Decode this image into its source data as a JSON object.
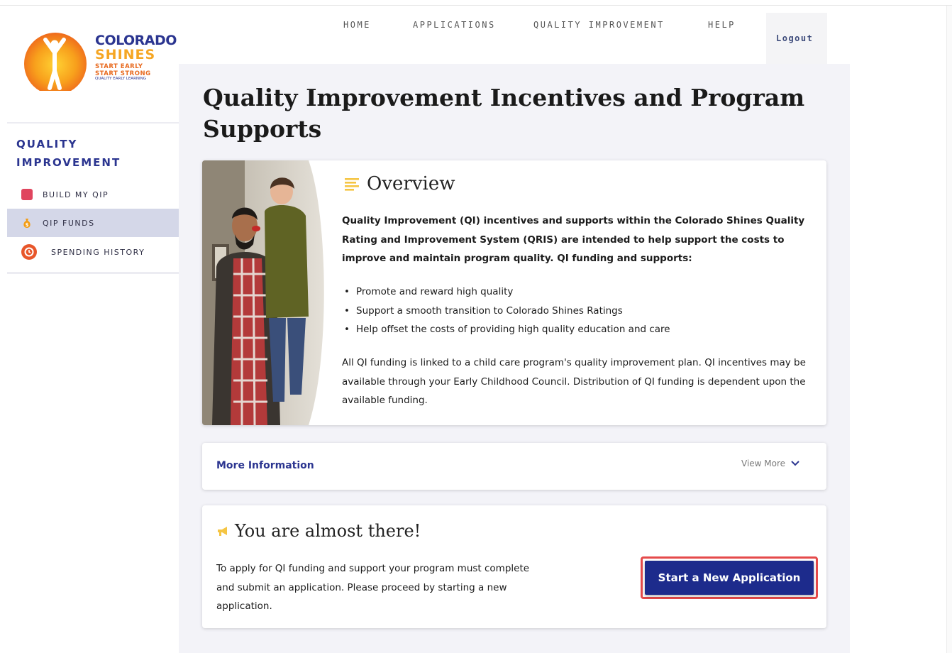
{
  "logo": {
    "line1": "COLORADO",
    "line2": "SHINES",
    "line3": "START EARLY",
    "line4": "START STRONG",
    "line5": "QUALITY EARLY LEARNING"
  },
  "nav": {
    "items": [
      "HOME",
      "APPLICATIONS",
      "QUALITY IMPROVEMENT",
      "HELP"
    ],
    "logout": "Logout"
  },
  "sidebar": {
    "title_line1": "QUALITY",
    "title_line2": "IMPROVEMENT",
    "items": [
      {
        "label": "BUILD MY QIP",
        "icon": "clipboard-icon",
        "color": "#e0455e",
        "active": false
      },
      {
        "label": "QIP FUNDS",
        "icon": "money-bag-icon",
        "color": "#f39c12",
        "active": true
      },
      {
        "label": "SPENDING HISTORY",
        "icon": "history-icon",
        "color": "#e8562a",
        "active": false
      }
    ]
  },
  "page": {
    "title": "Quality Improvement Incentives and Program Supports"
  },
  "overview": {
    "title": "Overview",
    "paragraph": "Quality Improvement (QI) incentives and supports within the Colorado Shines Quality Rating and Improvement System (QRIS) are intended to help support the costs to improve and maintain program quality. QI funding and supports:",
    "bullets": [
      "Promote and reward high quality",
      "Support a smooth transition to Colorado Shines Ratings",
      "Help offset the costs of providing high quality education and care"
    ],
    "paragraph2": "All QI funding is linked to a child care program's quality improvement plan. QI incentives may be available through your Early Childhood Council. Distribution of QI funding is dependent upon the available funding."
  },
  "more_info": {
    "label": "More Information",
    "view_more": "View More"
  },
  "almost": {
    "title": "You are almost there!",
    "text": "To apply for QI funding and support your program must complete and submit an application. Please proceed by starting a new application.",
    "button": "Start a New Application"
  },
  "colors": {
    "brand_navy": "#2b3590",
    "brand_orange": "#f5a623",
    "button_bg": "#1d2b8c",
    "highlight_border": "#e54a4a",
    "active_side_bg": "#d4d7e8"
  }
}
